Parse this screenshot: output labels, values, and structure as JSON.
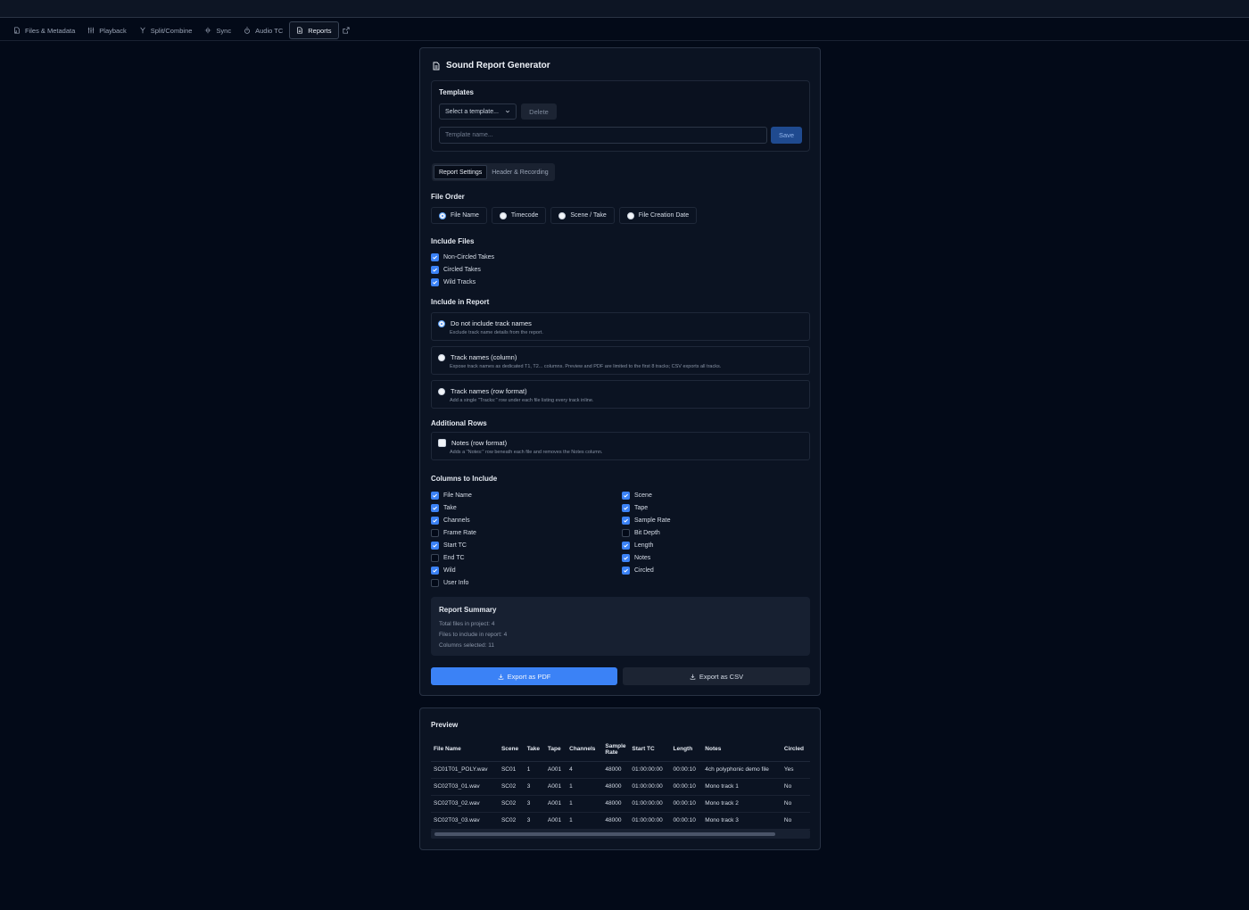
{
  "tabs": [
    {
      "label": "Files & Metadata",
      "icon": "file-audio-icon"
    },
    {
      "label": "Playback",
      "icon": "sliders-icon"
    },
    {
      "label": "Split/Combine",
      "icon": "split-icon"
    },
    {
      "label": "Sync",
      "icon": "waveform-icon"
    },
    {
      "label": "Audio TC",
      "icon": "timer-icon"
    },
    {
      "label": "Reports",
      "icon": "document-icon",
      "active": true
    }
  ],
  "report": {
    "title": "Sound Report Generator",
    "templates": {
      "heading": "Templates",
      "select_placeholder": "Select a template...",
      "delete_label": "Delete",
      "name_placeholder": "Template name...",
      "save_label": "Save"
    },
    "subtabs": [
      "Report Settings",
      "Header & Recording"
    ],
    "file_order": {
      "heading": "File Order",
      "options": [
        "File Name",
        "Timecode",
        "Scene / Take",
        "File Creation Date"
      ],
      "selected": "File Name"
    },
    "include_files": {
      "heading": "Include Files",
      "items": [
        {
          "label": "Non-Circled Takes",
          "checked": true
        },
        {
          "label": "Circled Takes",
          "checked": true
        },
        {
          "label": "Wild Tracks",
          "checked": true
        }
      ]
    },
    "include_in_report": {
      "heading": "Include in Report",
      "options": [
        {
          "label": "Do not include track names",
          "desc": "Exclude track name details from the report.",
          "selected": true
        },
        {
          "label": "Track names (column)",
          "desc": "Expose track names as dedicated T1, T2... columns. Preview and PDF are limited to the first 8 tracks; CSV exports all tracks.",
          "selected": false
        },
        {
          "label": "Track names (row format)",
          "desc": "Add a single \"Tracks:\" row under each file listing every track inline.",
          "selected": false
        }
      ]
    },
    "additional_rows": {
      "heading": "Additional Rows",
      "notes_label": "Notes (row format)",
      "notes_desc": "Adds a \"Notes:\" row beneath each file and removes the Notes column.",
      "notes_checked": false
    },
    "columns": {
      "heading": "Columns to Include",
      "left": [
        {
          "label": "File Name",
          "checked": true
        },
        {
          "label": "Take",
          "checked": true
        },
        {
          "label": "Channels",
          "checked": true
        },
        {
          "label": "Frame Rate",
          "checked": false
        },
        {
          "label": "Start TC",
          "checked": true
        },
        {
          "label": "End TC",
          "checked": false
        },
        {
          "label": "Wild",
          "checked": true
        },
        {
          "label": "User Info",
          "checked": false
        }
      ],
      "right": [
        {
          "label": "Scene",
          "checked": true
        },
        {
          "label": "Tape",
          "checked": true
        },
        {
          "label": "Sample Rate",
          "checked": true
        },
        {
          "label": "Bit Depth",
          "checked": false
        },
        {
          "label": "Length",
          "checked": true
        },
        {
          "label": "Notes",
          "checked": true
        },
        {
          "label": "Circled",
          "checked": true
        }
      ]
    },
    "summary": {
      "heading": "Report Summary",
      "total": "Total files in project: 4",
      "included": "Files to include in report: 4",
      "columns": "Columns selected: 11"
    },
    "export_pdf": "Export as PDF",
    "export_csv": "Export as CSV"
  },
  "preview": {
    "heading": "Preview",
    "headers": [
      "File Name",
      "Scene",
      "Take",
      "Tape",
      "Channels",
      "Sample Rate",
      "Start TC",
      "Length",
      "Notes",
      "Circled"
    ],
    "rows": [
      [
        "SC01T01_POLY.wav",
        "SC01",
        "1",
        "A001",
        "4",
        "48000",
        "01:00:00:00",
        "00:00:10",
        "4ch polyphonic demo file",
        "Yes"
      ],
      [
        "SC02T03_01.wav",
        "SC02",
        "3",
        "A001",
        "1",
        "48000",
        "01:00:00:00",
        "00:00:10",
        "Mono track 1",
        "No"
      ],
      [
        "SC02T03_02.wav",
        "SC02",
        "3",
        "A001",
        "1",
        "48000",
        "01:00:00:00",
        "00:00:10",
        "Mono track 2",
        "No"
      ],
      [
        "SC02T03_03.wav",
        "SC02",
        "3",
        "A001",
        "1",
        "48000",
        "01:00:00:00",
        "00:00:10",
        "Mono track 3",
        "No"
      ]
    ]
  },
  "colors": {
    "accent": "#3b82f6",
    "background": "#030a18",
    "card": "#0b1322"
  }
}
